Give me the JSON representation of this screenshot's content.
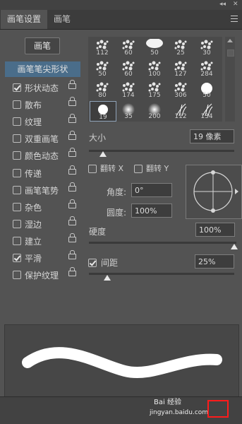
{
  "tabs": [
    {
      "label": "画笔设置"
    },
    {
      "label": "画笔"
    }
  ],
  "brush_button_label": "画笔",
  "tip_shape_label": "画笔笔尖形状",
  "options": [
    {
      "label": "形状动态",
      "checked": true
    },
    {
      "label": "散布",
      "checked": false
    },
    {
      "label": "纹理",
      "checked": false
    },
    {
      "label": "双重画笔",
      "checked": false
    },
    {
      "label": "颜色动态",
      "checked": false
    },
    {
      "label": "传递",
      "checked": false
    },
    {
      "label": "画笔笔势",
      "checked": false
    },
    {
      "label": "杂色",
      "checked": false
    },
    {
      "label": "湿边",
      "checked": false
    },
    {
      "label": "建立",
      "checked": false
    },
    {
      "label": "平滑",
      "checked": true
    },
    {
      "label": "保护纹理",
      "checked": false
    }
  ],
  "presets": [
    [
      "112",
      "60",
      "50",
      "25",
      "30"
    ],
    [
      "50",
      "60",
      "100",
      "127",
      "284"
    ],
    [
      "80",
      "174",
      "175",
      "306",
      "50"
    ],
    [
      "19",
      "35",
      "200",
      "112",
      "134"
    ]
  ],
  "size": {
    "label": "大小",
    "value": "19 像素"
  },
  "flip_x": {
    "label": "翻转 X",
    "checked": false
  },
  "flip_y": {
    "label": "翻转 Y",
    "checked": false
  },
  "angle": {
    "label": "角度:",
    "value": "0°"
  },
  "roundness": {
    "label": "圆度:",
    "value": "100%"
  },
  "hardness": {
    "label": "硬度",
    "value": "100%"
  },
  "spacing": {
    "label": "间距",
    "value": "25%",
    "checked": true
  },
  "watermark": {
    "line1": "Bai 经验",
    "line2": "jingyan.baidu.com"
  }
}
